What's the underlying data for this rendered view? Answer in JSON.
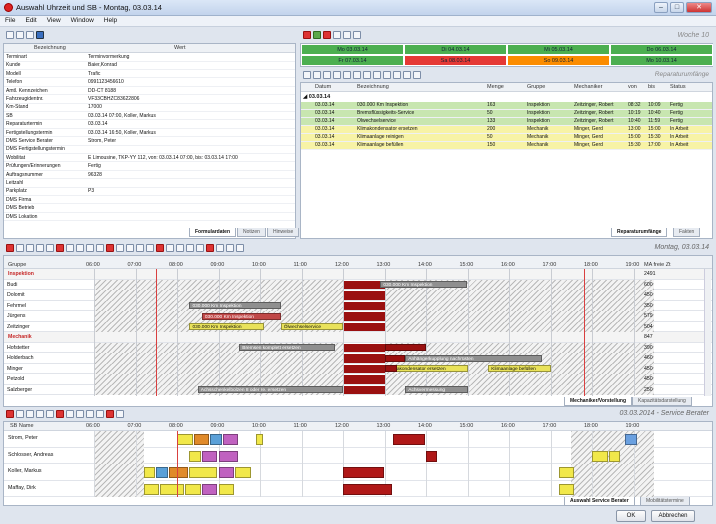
{
  "window": {
    "title": "Auswahl Uhrzeit und SB - Montag, 03.03.14"
  },
  "menu": [
    "File",
    "Edit",
    "View",
    "Window",
    "Help"
  ],
  "left_panel": {
    "col1": "Bezeichnung",
    "col2": "Wert",
    "rows": [
      [
        "Terminart",
        "Terminvormerkung"
      ],
      [
        "Kunde",
        "Baier,Konrad"
      ],
      [
        "Modell",
        "Trafic"
      ],
      [
        "Telefon",
        "0991123456610"
      ],
      [
        "Amtl. Kennzeichen",
        "DD-CT 8188"
      ],
      [
        "Fahrzeugidentnr.",
        "VF33CBHZC83622806"
      ],
      [
        "Km-Stand",
        "17000"
      ],
      [
        "SB",
        "03.03.14 07:00, Koller, Markus"
      ],
      [
        "Reparaturtermin",
        "03.03.14"
      ],
      [
        "Fertigstellungstermin",
        "03.03.14 16:50, Koller, Markus"
      ],
      [
        "DMS Service Berater",
        "Strom, Peter"
      ],
      [
        "DMS Fertigstellungstermin",
        ""
      ],
      [
        "Wobilitat",
        "E Limousine, TKP-YY 112, von: 03.03.14 07:00, bis: 03.03.14 17:00"
      ],
      [
        "Prüfungen/Erinnerungen",
        "Fertig"
      ],
      [
        "Auftragsnummer",
        "96328"
      ],
      [
        "Leitzahl",
        ""
      ],
      [
        "Parkplatz",
        "P3"
      ],
      [
        "DMS Firma",
        ""
      ],
      [
        "DMS Betrieb",
        ""
      ],
      [
        "DMS Lokation",
        ""
      ]
    ],
    "tabs": [
      "Formulardaten",
      "Notizen",
      "Hinweise"
    ]
  },
  "week": {
    "label": "Woche 10",
    "days": [
      {
        "label": "Mo 03.03.14",
        "status": "green"
      },
      {
        "label": "Di 04.03.14",
        "status": "green"
      },
      {
        "label": "Mi 05.03.14",
        "status": "green"
      },
      {
        "label": "Do 06.03.14",
        "status": "green"
      },
      {
        "label": "Fr 07.03.14",
        "status": "green"
      },
      {
        "label": "Sa 08.03.14",
        "status": "red"
      },
      {
        "label": "So 09.03.14",
        "status": "orange"
      },
      {
        "label": "Mo 10.03.14",
        "status": "green"
      }
    ]
  },
  "repair": {
    "label": "Reparaturumfänge",
    "cols": [
      "Datum",
      "Bezeichnung",
      "Menge",
      "Gruppe",
      "Mechaniker",
      "von",
      "bis",
      "Status"
    ],
    "group": "03.03.14",
    "rows": [
      {
        "c": [
          "03.03.14",
          "030.000 Km Inspektion",
          "163",
          "Inspektion",
          "Zeitzinger, Robert",
          "08:32",
          "10:09",
          "Fertig"
        ],
        "color": "#c8e6b0"
      },
      {
        "c": [
          "03.03.14",
          "Bremsflüssigkeits-Service",
          "50",
          "Inspektion",
          "Zeitzinger, Robert",
          "10:19",
          "10:40",
          "Fertig"
        ],
        "color": "#c8e6b0"
      },
      {
        "c": [
          "03.03.14",
          "Ölwechselservice",
          "133",
          "Inspektion",
          "Zeitzinger, Robert",
          "10:40",
          "11:59",
          "Fertig"
        ],
        "color": "#c8e6b0"
      },
      {
        "c": [
          "03.03.14",
          "Klimakondensator ersetzen",
          "200",
          "Mechanik",
          "Minger, Gerd",
          "13:00",
          "15:00",
          "In Arbeit"
        ],
        "color": "#f7f3a6"
      },
      {
        "c": [
          "03.03.14",
          "Klimaanlage reinigen",
          "50",
          "Mechanik",
          "Minger, Gerd",
          "15:00",
          "15:30",
          "In Arbeit"
        ],
        "color": "#f7f3a6"
      },
      {
        "c": [
          "03.03.14",
          "Klimaanlage befüllen",
          "150",
          "Mechanik",
          "Minger, Gerd",
          "15:30",
          "17:00",
          "In Arbeit"
        ],
        "color": "#f7f3a6"
      }
    ],
    "tabs": [
      "Reparaturumfänge",
      "Fakten"
    ]
  },
  "gantt1": {
    "header": "Montag, 03.03.14",
    "col_group": "Gruppe",
    "col_ma": "MA freie Zt",
    "hours": [
      "06:00",
      "07:00",
      "08:00",
      "09:00",
      "10:00",
      "11:00",
      "12:00",
      "13:00",
      "14:00",
      "15:00",
      "16:00",
      "17:00",
      "18:00",
      "19:00"
    ],
    "rows": [
      {
        "name": "Inspektion",
        "group": true,
        "val": "2491"
      },
      {
        "name": "Budi",
        "val": "600"
      },
      {
        "name": "Dolomit",
        "val": "450"
      },
      {
        "name": "Fehrmel",
        "val": "350"
      },
      {
        "name": "Jürgens",
        "val": "579"
      },
      {
        "name": "Zeitzinger",
        "val": "504"
      },
      {
        "name": "Mechanik",
        "group": true,
        "val": "847"
      },
      {
        "name": "Hofstetter",
        "val": "390"
      },
      {
        "name": "Holderbach",
        "val": "460"
      },
      {
        "name": "Minger",
        "val": "450"
      },
      {
        "name": "Petzold",
        "val": "450"
      },
      {
        "name": "Salzberger",
        "val": "250"
      }
    ],
    "bar_labels": {
      "insp": "030.000 Km Inspektion",
      "oel": "Ölwechselservice",
      "brems": "Bremsen komplett ersetzen",
      "anh": "Anhängerkupplung nachrüsten",
      "klimak": "Klimakondensator ersetzen",
      "klimab": "Klimaanlage befüllen",
      "achs": "Achsschenkelbolzen 8 oder re. ersetzen",
      "achsv": "Achsvermessung"
    },
    "tabs": [
      "Mechaniker/Vorstellung",
      "Kapazitätsdarstellung"
    ]
  },
  "gantt2": {
    "header": "03.03.2014 - Service Berater",
    "col_name": "SB Name",
    "rows": [
      "Strom, Peter",
      "Schlosser, Andreas",
      "Koller, Markus",
      "Maffay, Dirk"
    ],
    "tabs": [
      "Auswahl Service Berater",
      "Mobilitätstermine"
    ]
  },
  "buttons": {
    "ok": "OK",
    "cancel": "Abbrechen"
  }
}
